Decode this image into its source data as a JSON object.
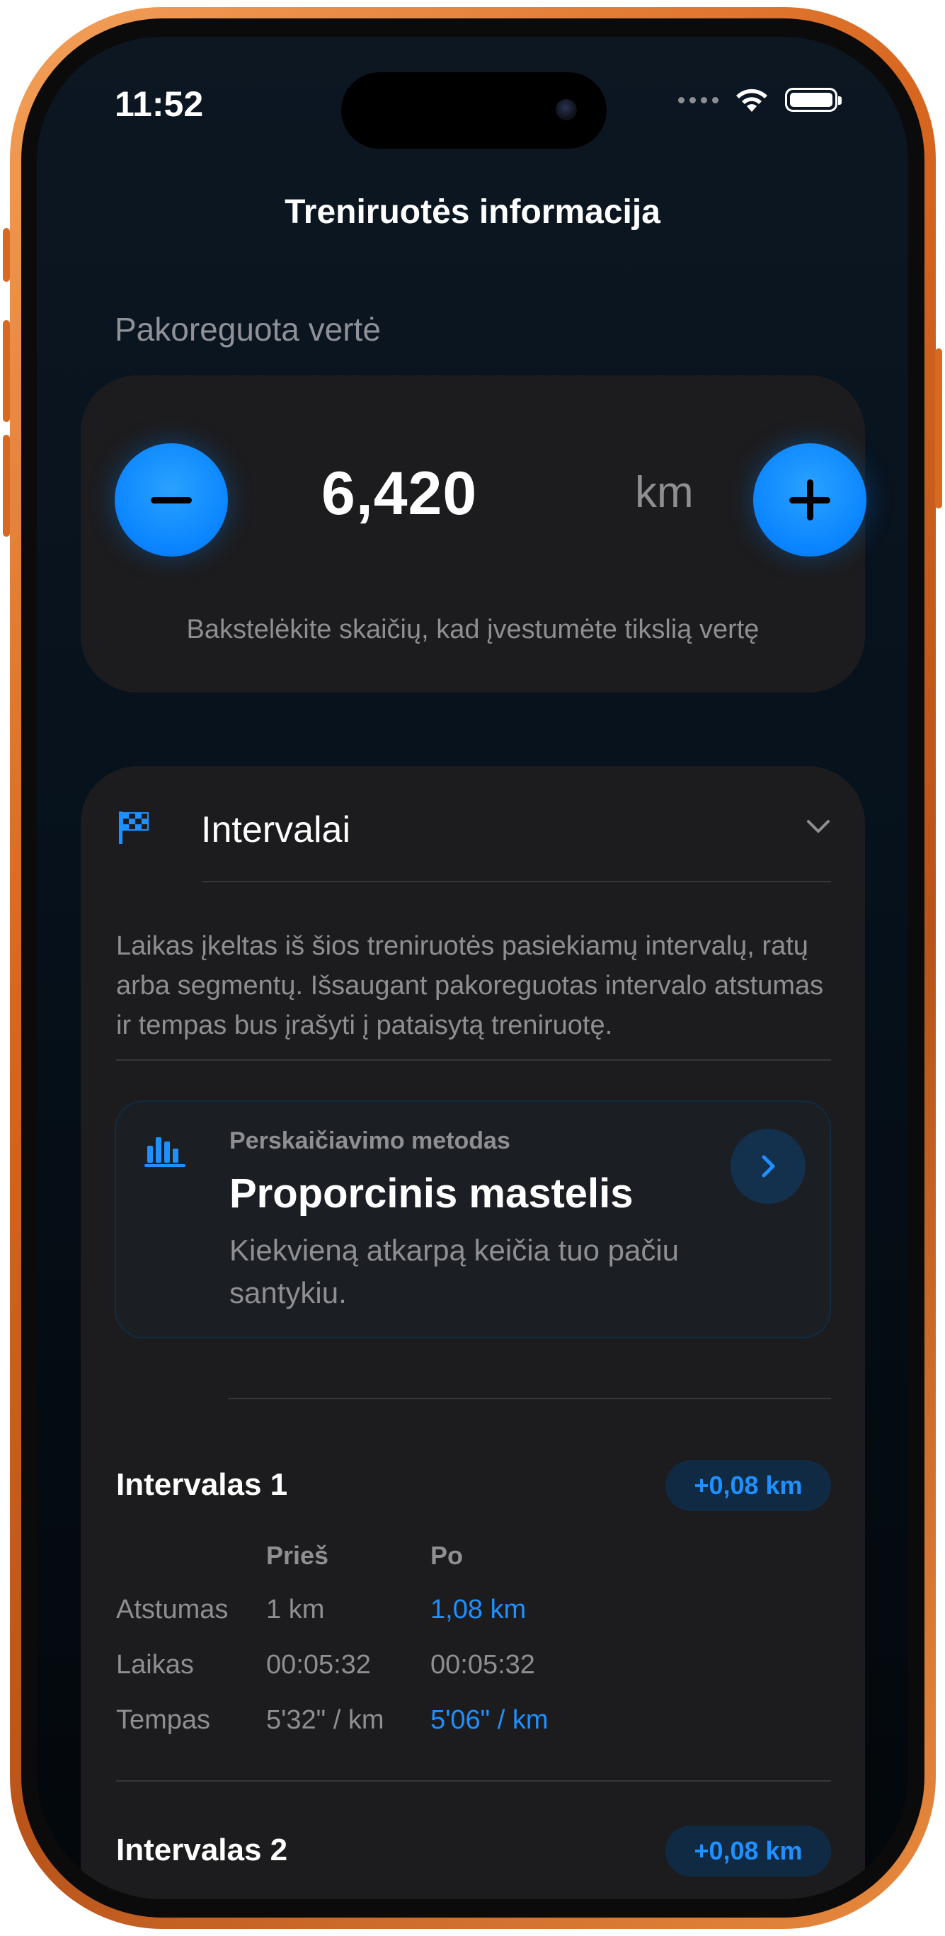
{
  "status_bar": {
    "time": "11:52"
  },
  "nav": {
    "title": "Treniruotės informacija"
  },
  "adjusted_value": {
    "section_label": "Pakoreguota vertė",
    "value": "6,420",
    "unit": "km",
    "hint": "Bakstelėkite skaičių, kad įvestumėte tikslią vertę"
  },
  "intervals": {
    "title": "Intervalai",
    "description": "Laikas įkeltas iš šios treniruotės pasiekiamų intervalų, ratų arba segmentų. Išsaugant pakoreguotas intervalo atstumas ir tempas bus įrašyti į pataisytą treniruotę.",
    "method": {
      "label": "Perskaičiavimo metodas",
      "title": "Proporcinis mastelis",
      "description": "Kiekvieną atkarpą keičia tuo pačiu santykiu."
    },
    "column_headers": {
      "before": "Prieš",
      "after": "Po"
    },
    "items": [
      {
        "title": "Intervalas 1",
        "delta": "+0,08 km",
        "rows": [
          {
            "label": "Atstumas",
            "before": "1 km",
            "after": "1,08 km"
          },
          {
            "label": "Laikas",
            "before": "00:05:32",
            "after": "00:05:32"
          },
          {
            "label": "Tempas",
            "before": "5'32\" / km",
            "after": "5'06\" / km"
          }
        ]
      },
      {
        "title": "Intervalas 2",
        "delta": "+0,08 km"
      }
    ]
  },
  "colors": {
    "accent": "#0a84ff",
    "card": "#1c1c1e",
    "frame": "#d8661f"
  }
}
